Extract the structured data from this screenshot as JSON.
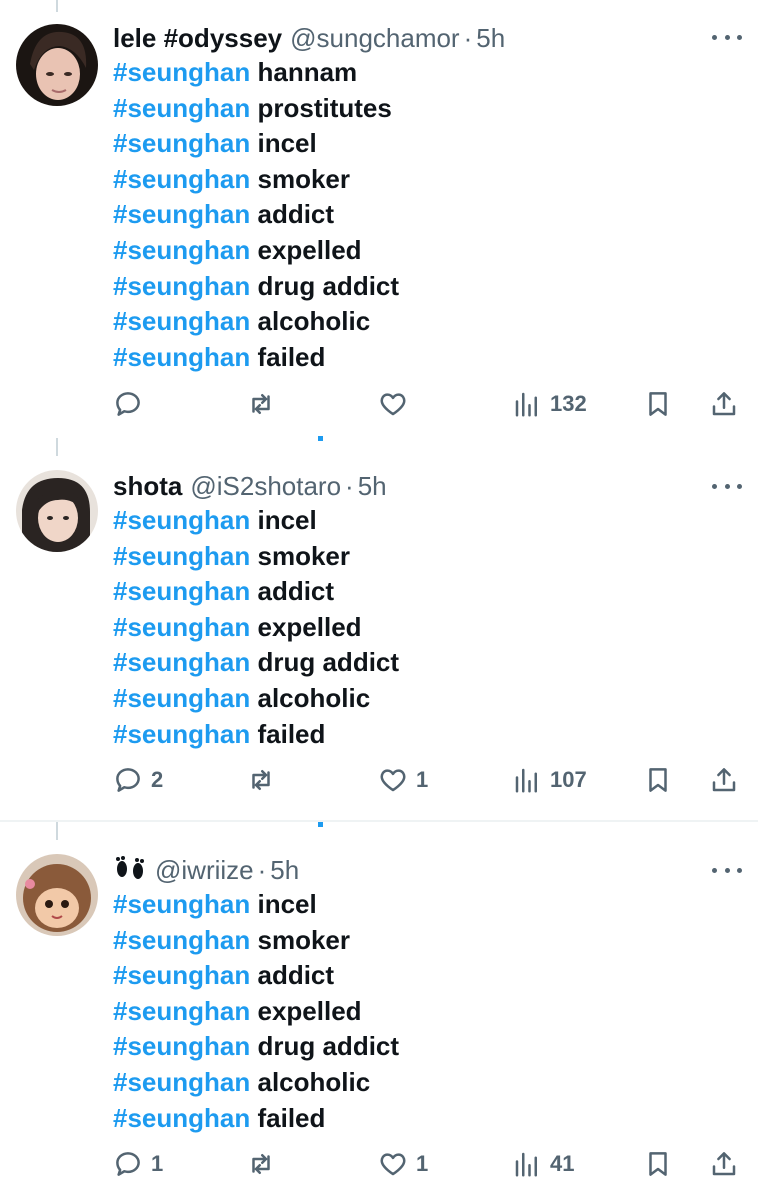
{
  "colors": {
    "accent": "#1d9bf0",
    "text": "#0f1419",
    "muted": "#536471",
    "divider": "#eff3f4"
  },
  "tweets": [
    {
      "name": "lele #odyssey",
      "handle": "@sungchamor",
      "dot": "·",
      "time": "5h",
      "lines": [
        {
          "tag": "#seunghan",
          "text": "hannam"
        },
        {
          "tag": "#seunghan",
          "text": "prostitutes"
        },
        {
          "tag": "#seunghan",
          "text": "incel"
        },
        {
          "tag": "#seunghan",
          "text": "smoker"
        },
        {
          "tag": "#seunghan",
          "text": "addict"
        },
        {
          "tag": "#seunghan",
          "text": "expelled"
        },
        {
          "tag": "#seunghan",
          "text": "drug addict"
        },
        {
          "tag": "#seunghan",
          "text": "alcoholic"
        },
        {
          "tag": "#seunghan",
          "text": "failed"
        }
      ],
      "actions": {
        "replies": "",
        "reposts": "",
        "likes": "",
        "views": "132"
      }
    },
    {
      "name": "shota",
      "handle": "@iS2shotaro",
      "dot": "·",
      "time": "5h",
      "lines": [
        {
          "tag": "#seunghan",
          "text": "incel"
        },
        {
          "tag": "#seunghan",
          "text": "smoker"
        },
        {
          "tag": "#seunghan",
          "text": "addict"
        },
        {
          "tag": "#seunghan",
          "text": "expelled"
        },
        {
          "tag": "#seunghan",
          "text": "drug addict"
        },
        {
          "tag": "#seunghan",
          "text": "alcoholic"
        },
        {
          "tag": "#seunghan",
          "text": "failed"
        }
      ],
      "actions": {
        "replies": "2",
        "reposts": "",
        "likes": "1",
        "views": "107"
      }
    },
    {
      "name": "",
      "name_icon": "footprints-icon",
      "handle": "@iwriize",
      "dot": "·",
      "time": "5h",
      "lines": [
        {
          "tag": "#seunghan",
          "text": "incel"
        },
        {
          "tag": "#seunghan",
          "text": "smoker"
        },
        {
          "tag": "#seunghan",
          "text": "addict"
        },
        {
          "tag": "#seunghan",
          "text": "expelled"
        },
        {
          "tag": "#seunghan",
          "text": "drug addict"
        },
        {
          "tag": "#seunghan",
          "text": "alcoholic"
        },
        {
          "tag": "#seunghan",
          "text": "failed"
        }
      ],
      "actions": {
        "replies": "1",
        "reposts": "",
        "likes": "1",
        "views": "41"
      }
    }
  ]
}
